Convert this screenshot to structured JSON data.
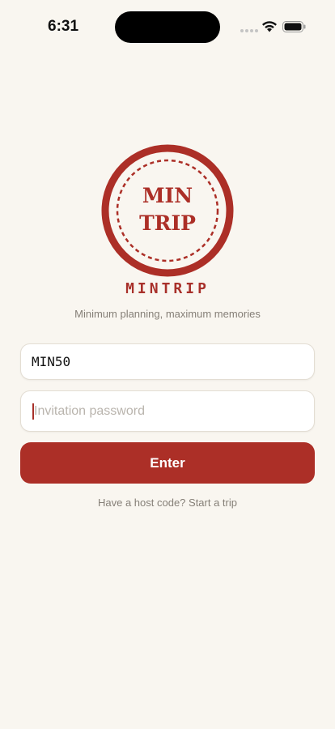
{
  "status_bar": {
    "time": "6:31",
    "icons": [
      "signal-icon",
      "wifi-icon",
      "battery-icon"
    ]
  },
  "logo": {
    "line1": "MIN",
    "line2": "TRIP",
    "color": "#ac2f27"
  },
  "brand": {
    "name": "MINTRIP",
    "tagline": "Minimum planning, maximum memories"
  },
  "form": {
    "code_value": "MIN50",
    "password_placeholder": "Invitation password",
    "password_value": "",
    "submit_label": "Enter",
    "host_link": "Have a host code? Start a trip"
  },
  "colors": {
    "background": "#f9f6f0",
    "accent": "#ac2f27",
    "muted_text": "#857f77"
  }
}
